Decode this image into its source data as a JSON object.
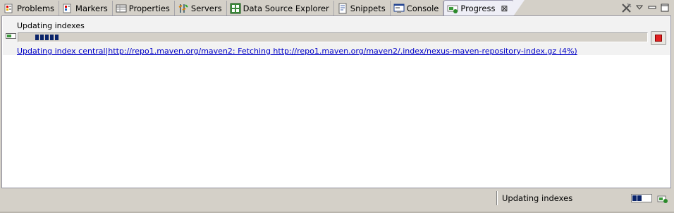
{
  "tabs": [
    {
      "label": "Problems",
      "icon": "problems-icon"
    },
    {
      "label": "Markers",
      "icon": "markers-icon"
    },
    {
      "label": "Properties",
      "icon": "properties-icon"
    },
    {
      "label": "Servers",
      "icon": "servers-icon"
    },
    {
      "label": "Data Source Explorer",
      "icon": "data-source-explorer-icon"
    },
    {
      "label": "Snippets",
      "icon": "snippets-icon"
    },
    {
      "label": "Console",
      "icon": "console-icon"
    },
    {
      "label": "Progress",
      "icon": "progress-icon",
      "active": true
    }
  ],
  "progress_view": {
    "job_title": "Updating indexes",
    "job_detail": "Updating index central|http://repo1.maven.org/maven2: Fetching http://repo1.maven.org/maven2/.index/nexus-maven-repository-index.gz (4%)",
    "indeterminate_blocks": 5
  },
  "statusbar": {
    "text": "Updating indexes"
  },
  "colors": {
    "accent": "#0a246a",
    "link": "#0000c8",
    "stop": "#e02020"
  }
}
